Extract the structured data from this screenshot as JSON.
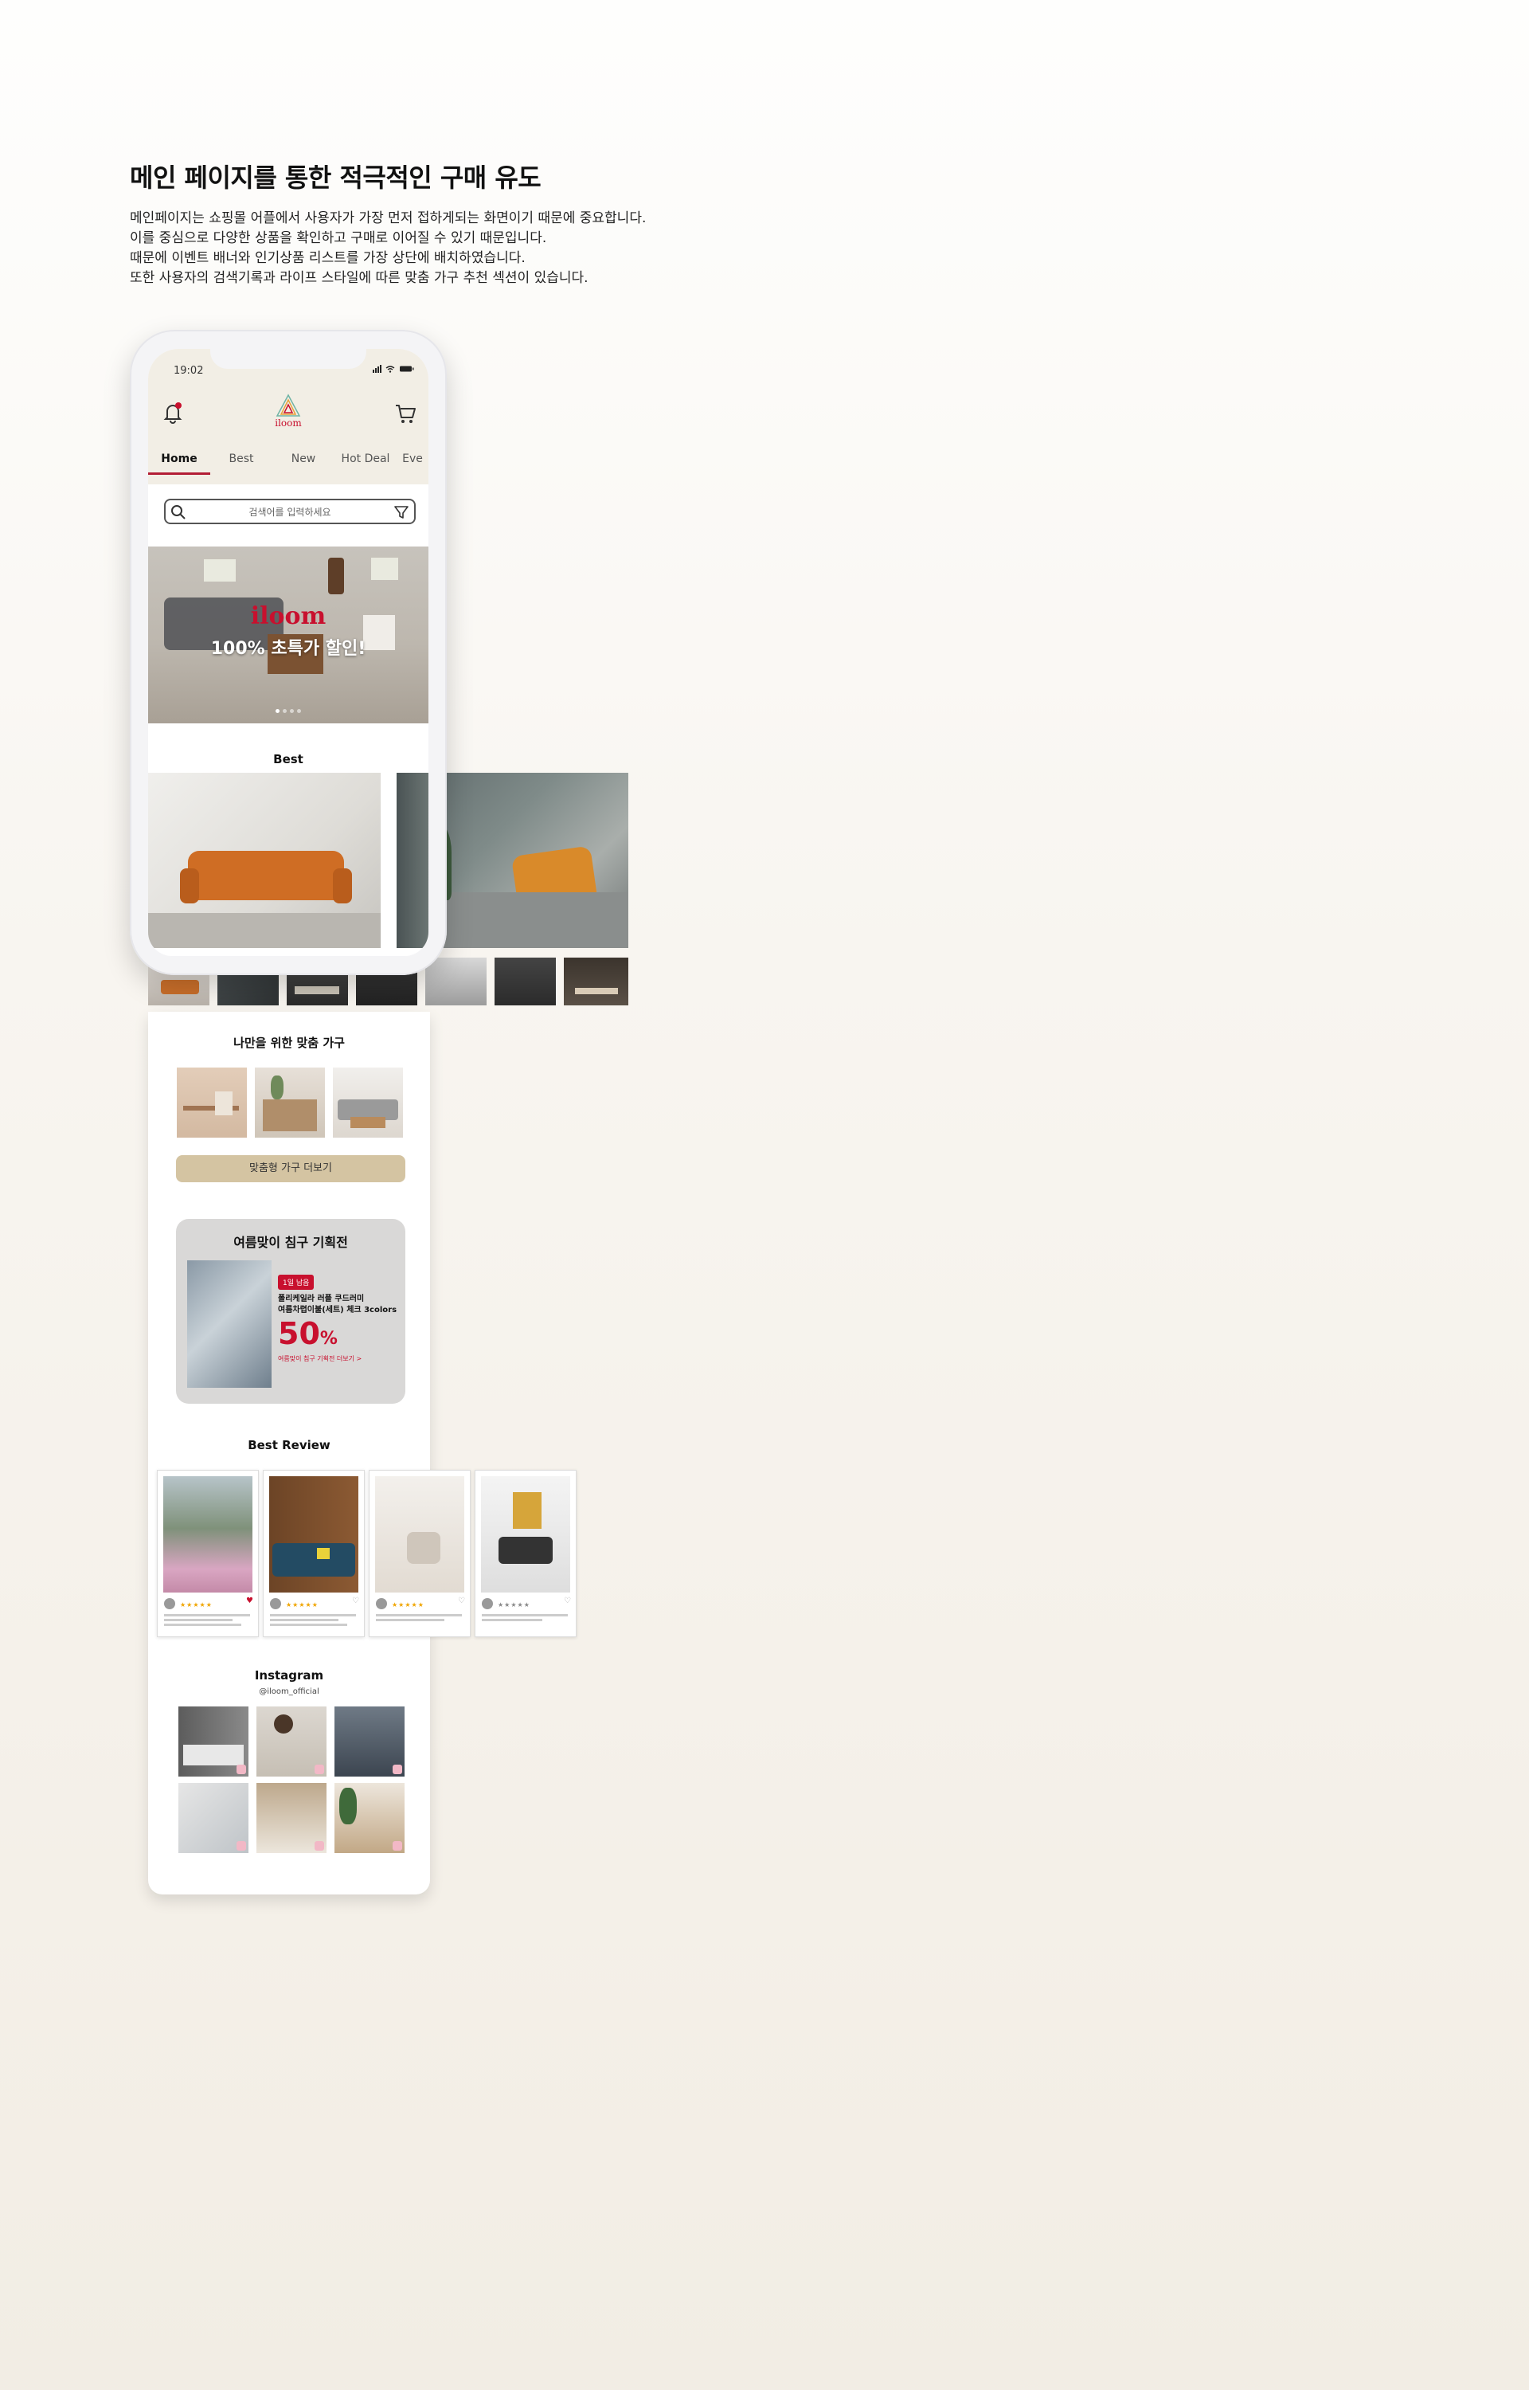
{
  "intro": {
    "heading": "메인 페이지를 통한 적극적인 구매 유도",
    "lines": [
      "메인페이지는 쇼핑몰 어플에서 사용자가 가장 먼저 접하게되는 화면이기 때문에 중요합니다.",
      "이를 중심으로 다양한 상품을 확인하고 구매로 이어질 수 있기 때문입니다.",
      "때문에 이벤트 배너와 인기상품 리스트를 가장 상단에 배치하였습니다.",
      "또한 사용자의 검색기록과 라이프 스타일에 따른 맞춤 가구 추천 섹션이 있습니다."
    ]
  },
  "phone": {
    "time": "19:02",
    "brand": "iloom",
    "tabs": [
      "Home",
      "Best",
      "New",
      "Hot Deal",
      "Eve"
    ],
    "active_tab": "Home",
    "search_placeholder": "검색어를 입력하세요",
    "banner": {
      "logo": "iloom",
      "copy": "100% 초특가 할인!",
      "slides": 4,
      "active_slide": 1
    },
    "best_title": "Best"
  },
  "custom": {
    "title": "나만을 위한 맞춤 가구",
    "button": "맞춤형 가구 더보기"
  },
  "promo": {
    "title": "여름맞이 침구 기획전",
    "tag": "1일 남음",
    "product_line1": "폴리케일라 러플 쿠드러미",
    "product_line2": "여름차렵이불(세트) 체크 3colors",
    "percent": "50",
    "percent_sign": "%",
    "link": "여름맞이 침구 기획전 더보기 >"
  },
  "reviews": {
    "title": "Best Review",
    "stars": [
      "★★★★★",
      "★★★★★",
      "★★★★★",
      "★★★★★"
    ]
  },
  "instagram": {
    "title": "Instagram",
    "handle": "@iloom_official"
  },
  "colors": {
    "accent": "#c8102e",
    "tab_underline": "#b31d35",
    "beige_button": "#d4c4a2",
    "header_bg": "#f2eee5"
  },
  "icons": [
    "bell-icon",
    "cart-icon",
    "search-icon",
    "filter-icon",
    "heart-icon",
    "instagram-icon"
  ]
}
